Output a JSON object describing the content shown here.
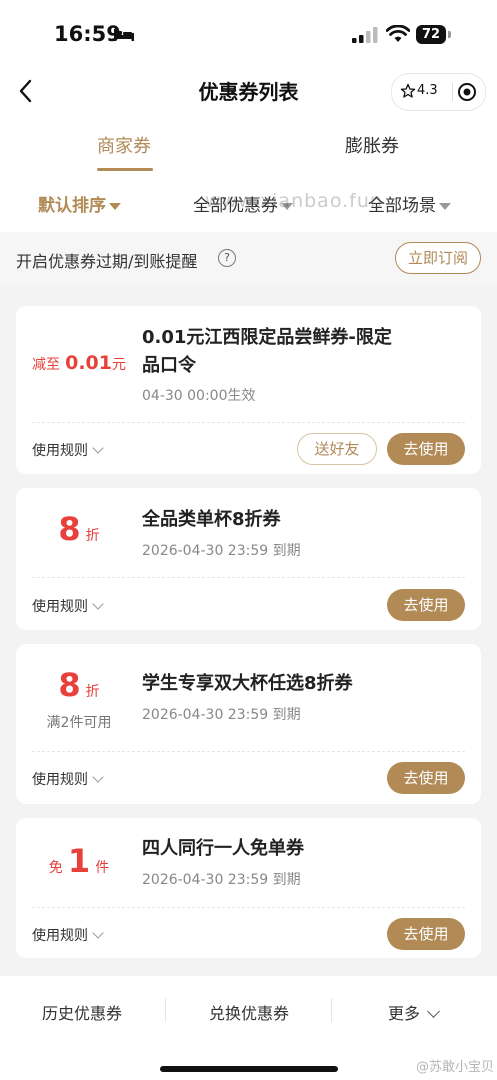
{
  "status": {
    "time": "16:59",
    "battery": "72"
  },
  "nav": {
    "title": "优惠券列表",
    "rating": "4.3"
  },
  "tabs": [
    {
      "label": "商家券"
    },
    {
      "label": "膨胀券"
    }
  ],
  "filters": {
    "sort": "默认排序",
    "type": "全部优惠券",
    "scene": "全部场景"
  },
  "watermark": "www.xianbao.fun",
  "notice": {
    "text": "开启优惠券过期/到账提醒",
    "button": "立即订阅"
  },
  "coupons": [
    {
      "prefix": "减至",
      "amount": "0.01",
      "suffix": "元",
      "title": "0.01元江西限定品尝鲜券-限定品口令",
      "title_line1": "0.01元江西限定品尝鲜券-限定",
      "title_line2": "品口令",
      "subtitle": "04-30 00:00生效",
      "rules": "使用规则",
      "gift": "送好友",
      "use": "去使用"
    },
    {
      "amount": "8",
      "suffix": "折",
      "title": "全品类单杯8折券",
      "subtitle": "2026-04-30 23:59 到期",
      "rules": "使用规则",
      "use": "去使用"
    },
    {
      "amount": "8",
      "suffix": "折",
      "condition": "满2件可用",
      "title": "学生专享双大杯任选8折券",
      "subtitle": "2026-04-30 23:59 到期",
      "rules": "使用规则",
      "use": "去使用"
    },
    {
      "prefix": "免",
      "amount": "1",
      "suffix": "件",
      "title": "四人同行一人免单券",
      "subtitle": "2026-04-30 23:59 到期",
      "rules": "使用规则",
      "use": "去使用"
    }
  ],
  "bottom": {
    "history": "历史优惠券",
    "redeem": "兑换优惠券",
    "more": "更多"
  },
  "weibo_mark": "@苏敢小宝贝",
  "colors": {
    "accent": "#b18a56",
    "price_red": "#e8403a"
  }
}
